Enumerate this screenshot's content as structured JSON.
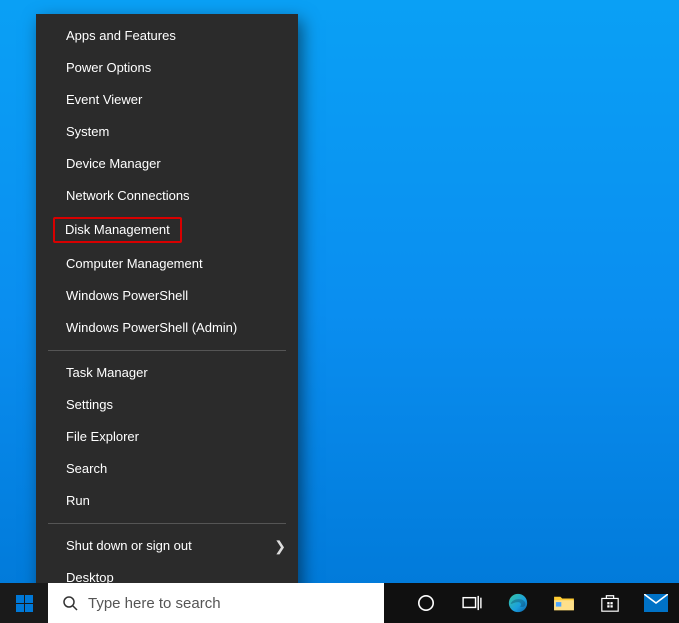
{
  "menu": {
    "group1": [
      "Apps and Features",
      "Power Options",
      "Event Viewer",
      "System",
      "Device Manager",
      "Network Connections",
      "Disk Management",
      "Computer Management",
      "Windows PowerShell",
      "Windows PowerShell (Admin)"
    ],
    "group2": [
      "Task Manager",
      "Settings",
      "File Explorer",
      "Search",
      "Run"
    ],
    "group3": [
      {
        "label": "Shut down or sign out",
        "submenu": true
      },
      {
        "label": "Desktop",
        "submenu": false
      }
    ],
    "highlighted_index": 6
  },
  "search": {
    "placeholder": "Type here to search"
  }
}
